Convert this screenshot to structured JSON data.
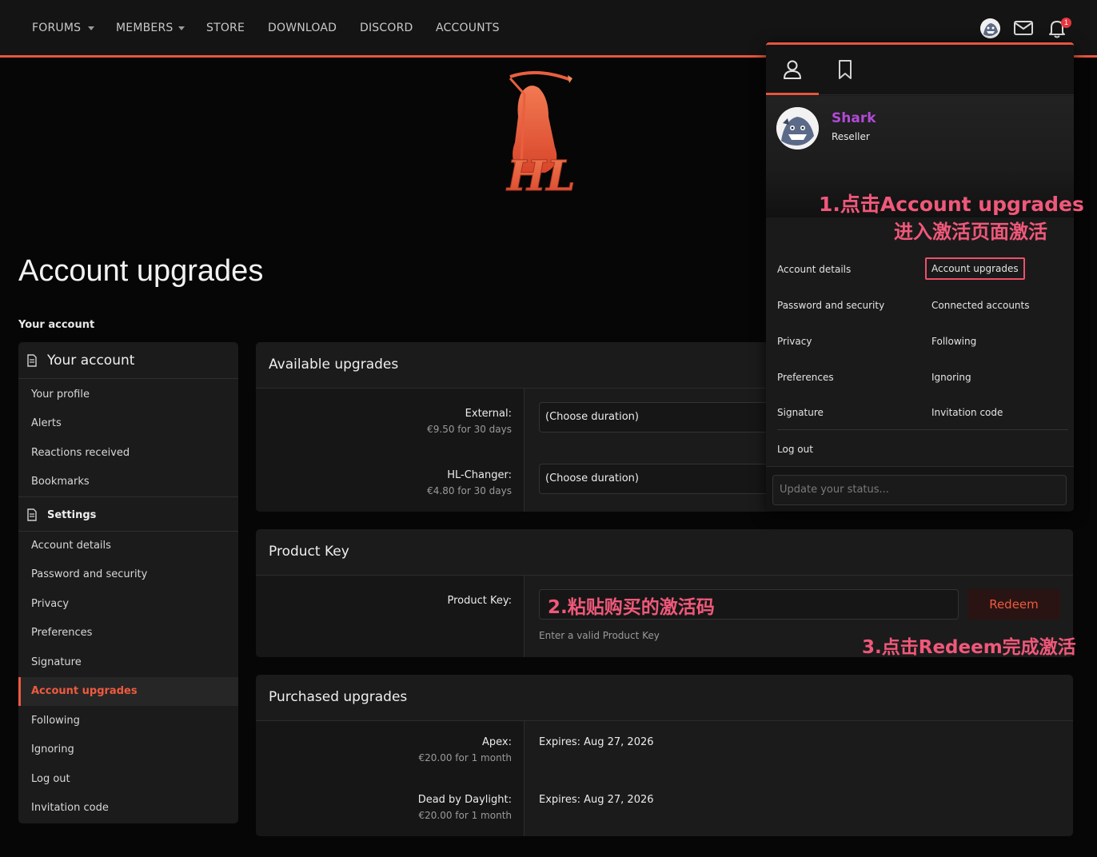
{
  "nav": {
    "items": [
      "FORUMS",
      "MEMBERS",
      "STORE",
      "DOWNLOAD",
      "DISCORD",
      "ACCOUNTS"
    ],
    "notification_count": "1",
    "icons": [
      "avatar",
      "envelope-icon",
      "bell-icon"
    ]
  },
  "logo": {
    "text": "HL"
  },
  "page": {
    "title": "Account upgrades",
    "section_label": "Your account"
  },
  "sidebar": {
    "group1_title": "Your account",
    "group1_items": [
      "Your profile",
      "Alerts",
      "Reactions received",
      "Bookmarks"
    ],
    "group2_title": "Settings",
    "group2_items": [
      "Account details",
      "Password and security",
      "Privacy",
      "Preferences",
      "Signature",
      "Account upgrades",
      "Following",
      "Ignoring",
      "Log out",
      "Invitation code"
    ],
    "active": "Account upgrades"
  },
  "available": {
    "title": "Available upgrades",
    "rows": [
      {
        "label": "External:",
        "hint": "€9.50 for 30 days",
        "select": "(Choose duration)"
      },
      {
        "label": "HL-Changer:",
        "hint": "€4.80 for 30 days",
        "select": "(Choose duration)"
      }
    ]
  },
  "product_key": {
    "title": "Product Key",
    "label": "Product Key:",
    "button": "Redeem",
    "hint": "Enter a valid Product Key"
  },
  "purchased": {
    "title": "Purchased upgrades",
    "rows": [
      {
        "label": "Apex:",
        "hint": "€20.00 for 1 month",
        "value": "Expires: Aug 27, 2026"
      },
      {
        "label": "Dead by Daylight:",
        "hint": "€20.00 for 1 month",
        "value": "Expires: Aug 27, 2026"
      }
    ]
  },
  "menu": {
    "username": "Shark",
    "role": "Reseller",
    "links_left": [
      "Account details",
      "Password and security",
      "Privacy",
      "Preferences",
      "Signature"
    ],
    "links_right": [
      "Account upgrades",
      "Connected accounts",
      "Following",
      "Ignoring",
      "Invitation code"
    ],
    "logout": "Log out",
    "status_placeholder": "Update your status...",
    "tabs": [
      "user-icon",
      "bookmark-icon"
    ]
  },
  "annotations": {
    "step1_line1": "1.点击Account upgrades",
    "step1_line2": "进入激活页面激活",
    "step2": "2.粘贴购买的激活码",
    "step3": "3.点击Redeem完成激活"
  },
  "colors": {
    "accent": "#e8553d",
    "annotation": "#f0587a",
    "username": "#b24ad6",
    "background": "#060606",
    "panel": "#1b1b1b"
  }
}
